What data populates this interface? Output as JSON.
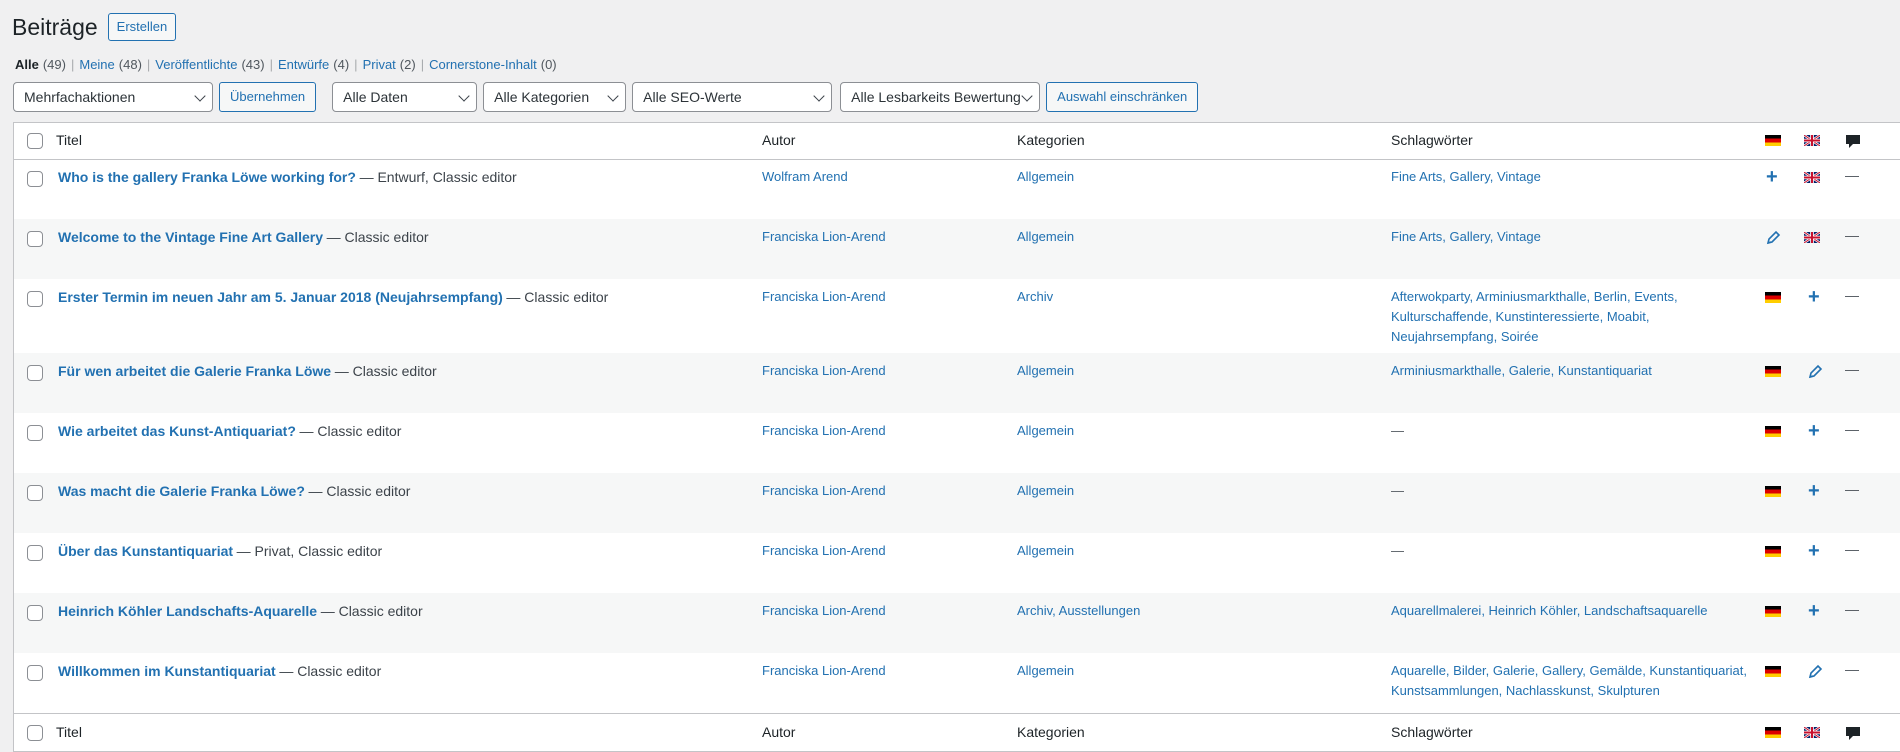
{
  "header": {
    "title": "Beiträge",
    "add_button": "Erstellen"
  },
  "views": [
    {
      "label": "Alle",
      "count": "(49)"
    },
    {
      "label": "Meine",
      "count": "(48)"
    },
    {
      "label": "Veröffentlichte",
      "count": "(43)"
    },
    {
      "label": "Entwürfe",
      "count": "(4)"
    },
    {
      "label": "Privat",
      "count": "(2)"
    },
    {
      "label": "Cornerstone-Inhalt",
      "count": "(0)"
    }
  ],
  "toolbar": {
    "bulk_action": "Mehrfachaktionen",
    "apply": "Übernehmen",
    "date_filter": "Alle Daten",
    "category_filter": "Alle Kategorien",
    "seo_filter": "Alle SEO-Werte",
    "readability_filter": "Alle Lesbarkeits Bewertung",
    "filter_button": "Auswahl einschränken"
  },
  "columns": {
    "title": "Titel",
    "author": "Autor",
    "categories": "Kategorien",
    "tags": "Schlagwörter"
  },
  "rows": [
    {
      "title": "Who is the gallery Franka Löwe working for?",
      "state": "— Entwurf, Classic editor",
      "author": "Wolfram Arend",
      "categories": "Allgemein",
      "tags_lines": [
        "Fine Arts, Gallery, Vintage"
      ],
      "lang_de": "plus",
      "lang_en": "flag"
    },
    {
      "title": "Welcome to the Vintage Fine Art Gallery",
      "state": "— Classic editor",
      "author": "Franciska Lion-Arend",
      "categories": "Allgemein",
      "tags_lines": [
        "Fine Arts, Gallery, Vintage"
      ],
      "lang_de": "pencil",
      "lang_en": "flag"
    },
    {
      "title": "Erster Termin im neuen Jahr am 5. Januar 2018 (Neujahrsempfang)",
      "state": "— Classic editor",
      "author": "Franciska Lion-Arend",
      "categories": "Archiv",
      "tags_lines": [
        "Afterwokparty, Arminiusmarkthalle, Berlin, Events,",
        "Kulturschaffende, Kunstinteressierte, Moabit,",
        "Neujahrsempfang, Soirée"
      ],
      "lang_de": "flag",
      "lang_en": "plus"
    },
    {
      "title": "Für wen arbeitet die Galerie Franka Löwe",
      "state": "— Classic editor",
      "author": "Franciska Lion-Arend",
      "categories": "Allgemein",
      "tags_lines": [
        "Arminiusmarkthalle, Galerie, Kunstantiquariat"
      ],
      "lang_de": "flag",
      "lang_en": "pencil"
    },
    {
      "title": "Wie arbeitet das Kunst-Antiquariat?",
      "state": "— Classic editor",
      "author": "Franciska Lion-Arend",
      "categories": "Allgemein",
      "tags_lines": [
        "—"
      ],
      "lang_de": "flag",
      "lang_en": "plus"
    },
    {
      "title": "Was macht die Galerie Franka Löwe?",
      "state": "— Classic editor",
      "author": "Franciska Lion-Arend",
      "categories": "Allgemein",
      "tags_lines": [
        "—"
      ],
      "lang_de": "flag",
      "lang_en": "plus"
    },
    {
      "title": "Über das Kunstantiquariat",
      "state": "— Privat, Classic editor",
      "author": "Franciska Lion-Arend",
      "categories": "Allgemein",
      "tags_lines": [
        "—"
      ],
      "lang_de": "flag",
      "lang_en": "plus"
    },
    {
      "title": "Heinrich Köhler Landschafts-Aquarelle",
      "state": "— Classic editor",
      "author": "Franciska Lion-Arend",
      "categories": "Archiv, Ausstellungen",
      "tags_lines": [
        "Aquarellmalerei, Heinrich Köhler, Landschaftsaquarelle"
      ],
      "lang_de": "flag",
      "lang_en": "plus"
    },
    {
      "title": "Willkommen im Kunstantiquariat",
      "state": "— Classic editor",
      "author": "Franciska Lion-Arend",
      "categories": "Allgemein",
      "tags_lines": [
        "Aquarelle, Bilder, Galerie, Gallery, Gemälde, Kunstantiquariat,",
        "Kunstsammlungen, Nachlasskunst, Skulpturen"
      ],
      "lang_de": "flag",
      "lang_en": "pencil"
    }
  ],
  "comments_dash": "—",
  "colors": {
    "link": "#2271b1",
    "background": "#f0f0f1",
    "alt_row": "#f6f7f7"
  }
}
